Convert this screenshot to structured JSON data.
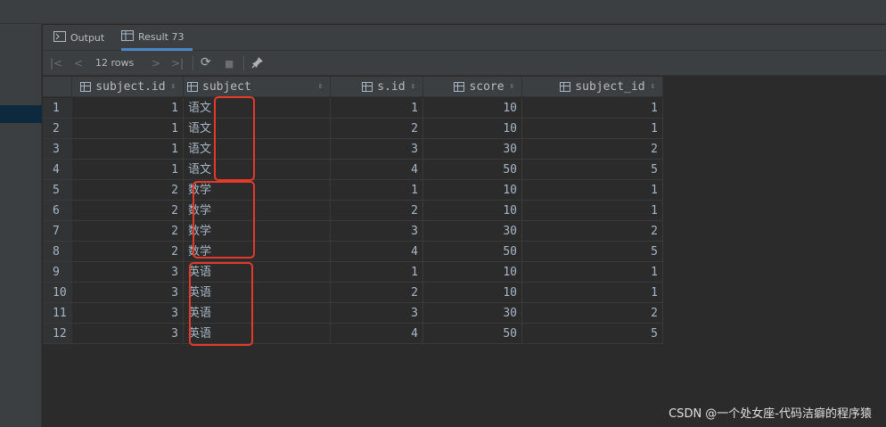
{
  "tabs": [
    {
      "label": "Output",
      "icon": "output-icon"
    },
    {
      "label": "Result 73",
      "icon": "table-icon"
    }
  ],
  "toolbar": {
    "rows_label": "12 rows",
    "first_icon": "|<",
    "prev_icon": "<",
    "next_icon": ">",
    "last_icon": ">|",
    "refresh_icon": "⟳",
    "stop_icon": "■",
    "pin_icon": "📌"
  },
  "columns": [
    {
      "label": "subject.id",
      "sort": "⇕"
    },
    {
      "label": "subject",
      "sort": "⇕"
    },
    {
      "label": "s.id",
      "sort": "⇕"
    },
    {
      "label": "score",
      "sort": "⇕"
    },
    {
      "label": "subject_id",
      "sort": "⇕"
    }
  ],
  "rows": [
    {
      "n": "1",
      "cells": [
        "1",
        "语文",
        "1",
        "10",
        "1"
      ]
    },
    {
      "n": "2",
      "cells": [
        "1",
        "语文",
        "2",
        "10",
        "1"
      ]
    },
    {
      "n": "3",
      "cells": [
        "1",
        "语文",
        "3",
        "30",
        "2"
      ]
    },
    {
      "n": "4",
      "cells": [
        "1",
        "语文",
        "4",
        "50",
        "5"
      ]
    },
    {
      "n": "5",
      "cells": [
        "2",
        "数学",
        "1",
        "10",
        "1"
      ]
    },
    {
      "n": "6",
      "cells": [
        "2",
        "数学",
        "2",
        "10",
        "1"
      ]
    },
    {
      "n": "7",
      "cells": [
        "2",
        "数学",
        "3",
        "30",
        "2"
      ]
    },
    {
      "n": "8",
      "cells": [
        "2",
        "数学",
        "4",
        "50",
        "5"
      ]
    },
    {
      "n": "9",
      "cells": [
        "3",
        "英语",
        "1",
        "10",
        "1"
      ]
    },
    {
      "n": "10",
      "cells": [
        "3",
        "英语",
        "2",
        "10",
        "1"
      ]
    },
    {
      "n": "11",
      "cells": [
        "3",
        "英语",
        "3",
        "30",
        "2"
      ]
    },
    {
      "n": "12",
      "cells": [
        "3",
        "英语",
        "4",
        "50",
        "5"
      ]
    }
  ],
  "watermark": "CSDN @一个处女座-代码洁癖的程序猿",
  "colors": {
    "highlight_box": "#e53a2a",
    "active_tab_underline": "#4a88c7"
  }
}
